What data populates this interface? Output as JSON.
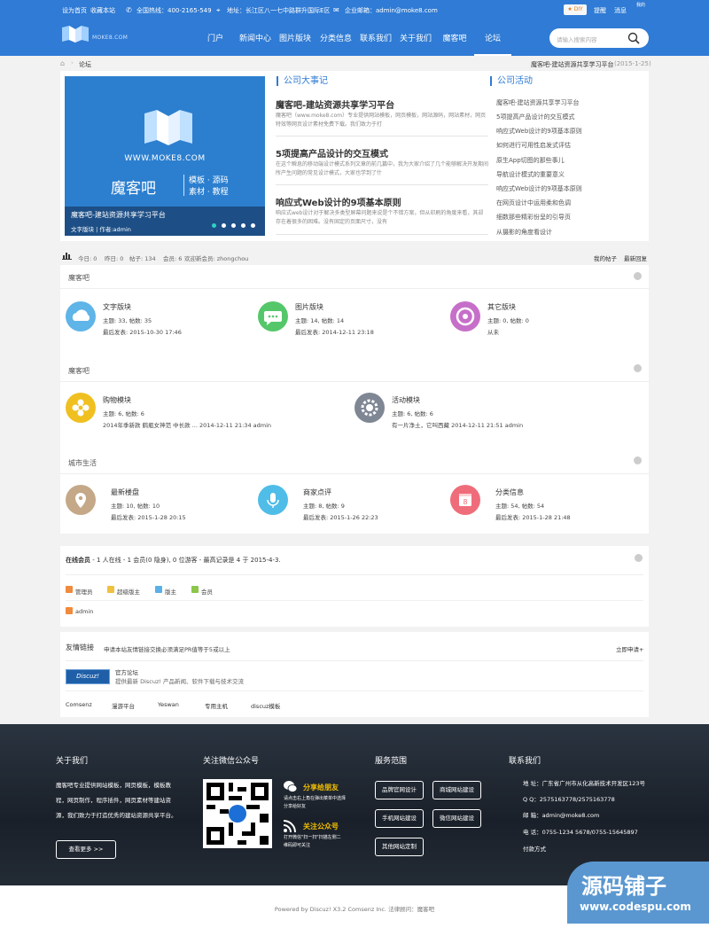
{
  "topbar": {
    "set_home": "设为首页",
    "favorite": "收藏本站",
    "hotline": "全国热线：400-2165-549",
    "address": "地址：长江区八一七中路群升国际E区",
    "email": "企业邮箱：admin@moke8.com",
    "diy": "DIY",
    "remind": "提醒",
    "message": "消息",
    "avatar": "我的"
  },
  "logo": {
    "text": "MOKE8.COM"
  },
  "nav": {
    "items": [
      "门户",
      "新闻中心",
      "图片版块",
      "分类信息",
      "联系我们",
      "关于我们",
      "魔客吧",
      "论坛"
    ]
  },
  "search": {
    "placeholder": "请输入搜索内容"
  },
  "breadcrumb": {
    "current": "论坛",
    "right_title": "魔客吧-建站资源共享学习平台",
    "right_date": "(2015-1-25)"
  },
  "slide": {
    "url": "WWW.MOKE8.COM",
    "brand": "魔客吧",
    "tagline1": "模板 · 源码",
    "tagline2": "素材 · 教程",
    "caption": "魔客吧-建站资源共享学习平台",
    "meta": "文字版块 | 作者:admin"
  },
  "events": {
    "title": "公司大事记",
    "items": [
      {
        "title": "魔客吧-建站资源共享学习平台",
        "desc": "魔客吧（www.moke8.com）专业提供网站模板，网页模板，网站源码，网站素材，网页特效等网页设计素材免费下载。我们致力于打"
      },
      {
        "title": "5项提高产品设计的交互模式",
        "desc": "在这个瞬息的移动端设计模式系列文章的前几篇中，我为大家介绍了几个能够解决开发期间所产生问题的常见设计模式，大家也学到了什"
      },
      {
        "title": "响应式Web设计的9项基本原则",
        "desc": "响应式web设计对于解决多类型屏幕问题来说是个不错方案，但从印刷的角度来看，其却存在着很多的困难。没有固定的页面尺寸，没有"
      }
    ]
  },
  "activities": {
    "title": "公司活动",
    "items": [
      "魔客吧-建站资源共享学习平台",
      "5项提高产品设计的交互模式",
      "响应式Web设计的9项基本原则",
      "如何进行可用性启发式评估",
      "原生App切图的那些事儿",
      "导航设计模式的重要意义",
      "响应式Web设计的9项基本原则",
      "在网页设计中运用柔和色调",
      "细数那些精彩份呈的引导页",
      "从摄影的角度看设计"
    ]
  },
  "stats": {
    "today": "今日: 0",
    "yesterday": "昨日: 0",
    "posts": "帖子: 134",
    "members": "会员: 6",
    "welcome": "欢迎新会员: zhongchou",
    "my_posts": "我的帖子",
    "latest": "最新回复"
  },
  "groups": [
    {
      "title": "魔客吧",
      "forums": [
        {
          "name": "文字版块",
          "stats": "主题: 33, 帖数: 35",
          "last": "最后发表: 2015-10-30 17:46",
          "color": "#5fb4e8"
        },
        {
          "name": "图片版块",
          "stats": "主题: 14, 帖数: 14",
          "last": "最后发表: 2014-12-11 23:18",
          "color": "#55c76b"
        },
        {
          "name": "其它版块",
          "stats": "主题: 0, 帖数: 0",
          "last": "从未",
          "color": "#c66fc9"
        }
      ]
    },
    {
      "title": "魔客吧",
      "forums": [
        {
          "name": "购物模块",
          "stats": "主题: 6, 帖数: 6",
          "last": "2014年季新款 鹤瓶女神范 中长款 ... 2014-12-11 21:34 admin",
          "color": "#f0c020"
        },
        {
          "name": "活动模块",
          "stats": "主题: 6, 帖数: 6",
          "last": "有一片净土，它叫西藏 2014-12-11 21:51 admin",
          "color": "#7f8694"
        }
      ]
    },
    {
      "title": "城市生活",
      "forums": [
        {
          "name": "最新楼盘",
          "stats": "主题: 10, 帖数: 10",
          "last": "最后发表: 2015-1-28 20:15",
          "color": "#c4a888"
        },
        {
          "name": "商家点评",
          "stats": "主题: 8, 帖数: 9",
          "last": "最后发表: 2015-1-26 22:23",
          "color": "#4fbde8"
        },
        {
          "name": "分类信息",
          "stats": "主题: 54, 帖数: 54",
          "last": "最后发表: 2015-1-28 21:48",
          "color": "#ef6d7a"
        }
      ]
    }
  ],
  "online": {
    "summary_prefix": "在线会员",
    "summary": " - 1 人在线 - 1 会员(0 隐身), 0 位游客 - 最高记录是 4 于 2015-4-3.",
    "legend": [
      "管理员",
      "超级版主",
      "版主",
      "会员"
    ],
    "user": "admin"
  },
  "links": {
    "title": "友情链接",
    "desc": "申请本站友情链接交换必须满足PR值等于5或以上",
    "apply": "立即申请+",
    "official_name": "官方论坛",
    "official_desc": "提供最新 Discuz! 产品新闻、软件下载与技术交流",
    "official_logo": "Discuz!",
    "text_links": [
      "Comsenz",
      "漫游平台",
      "Yeswan",
      "专用主机",
      "discuz模板"
    ]
  },
  "footer": {
    "about_title": "关于我们",
    "about_text": "魔客吧专业提供网站模板，网页模板，模板教程，网页制作，程序插件，网页素材等建站资源，我们致力于打造优秀的建站资源共享平台。",
    "more_btn": "查看更多 >>",
    "wechat_title": "关注微信公众号",
    "share_title": "分享给朋友",
    "share_desc1": "请点击右上角在弹出菜单中选择",
    "share_desc2": "分享给好友",
    "follow_title": "关注公众号",
    "follow_desc1": "打开微信\"扫一扫\"扫描左侧二",
    "follow_desc2": "维码即可关注",
    "service_title": "服务范围",
    "services": [
      "品牌官网设计",
      "商城网站建设",
      "手机网站建设",
      "微信网站建设",
      "其他网站定制"
    ],
    "contact_title": "联系我们",
    "contact": [
      "地 址：广东省广州市从化高新技术开发区123号",
      "Q Q：2575163778/2575163778",
      "邮 箱：admin@moke8.com",
      "电 话：0755-1234 5678/0755-15645897",
      "付款方式"
    ]
  },
  "copyright": "Powered by Discuz! X3.2 Comsenz Inc. 法律顾问：魔客吧",
  "watermark": {
    "line1": "源码铺子",
    "line2": "www.codespu.com"
  }
}
